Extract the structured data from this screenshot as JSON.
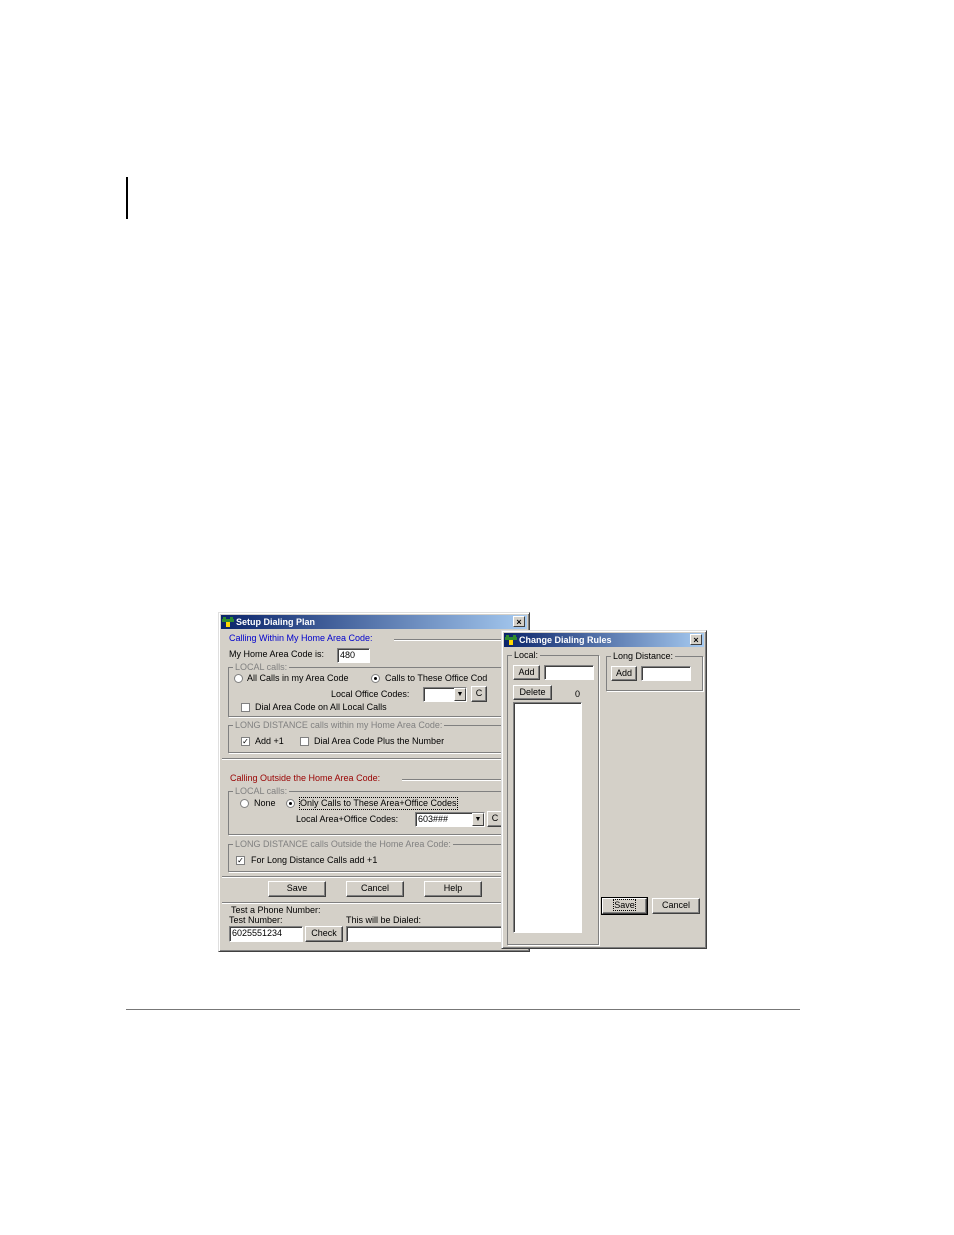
{
  "setup_dialog": {
    "title": "Setup Dialing Plan",
    "close": "×",
    "within_home": {
      "heading": "Calling Within My Home Area Code:",
      "home_area_label": "My Home Area Code is:",
      "home_area_value": "480",
      "local_calls": {
        "title": "LOCAL calls:",
        "option_all": "All Calls in my Area Code",
        "option_these": "Calls to These Office Cod",
        "selected": "option_these",
        "office_codes_label": "Local Office Codes:",
        "office_codes_value": "",
        "c_button": "C",
        "dial_area_code_label": "Dial Area Code on All Local Calls",
        "dial_area_code_checked": false
      },
      "long_distance": {
        "title": "LONG DISTANCE calls within my Home Area Code:",
        "add_one_label": "Add +1",
        "add_one_checked": true,
        "dial_area_plus_label": "Dial Area Code Plus the Number",
        "dial_area_plus_checked": false
      }
    },
    "outside_home": {
      "heading": "Calling Outside the Home Area Code:",
      "local_calls": {
        "title": "LOCAL calls:",
        "option_none": "None",
        "option_only": "Only Calls to These Area+Office Codes",
        "selected": "option_only",
        "codes_label": "Local Area+Office Codes:",
        "codes_value": "603###",
        "c_button": "C"
      },
      "long_distance": {
        "title": "LONG DISTANCE calls Outside the Home Area Code:",
        "add_one_label": "For Long Distance Calls add +1",
        "add_one_checked": true
      }
    },
    "buttons": {
      "save": "Save",
      "cancel": "Cancel",
      "help": "Help"
    },
    "test": {
      "title": "Test a Phone Number:",
      "number_label": "Test Number:",
      "number_value": "6025551234",
      "check_button": "Check",
      "dialed_label": "This will be Dialed:",
      "dialed_value": ""
    }
  },
  "rules_dialog": {
    "title": "Change Dialing Rules",
    "close": "×",
    "local": {
      "title": "Local:",
      "add_button": "Add",
      "add_value": "",
      "delete_button": "Delete",
      "count": "0"
    },
    "long_distance": {
      "title": "Long Distance:",
      "add_button": "Add",
      "add_value": ""
    },
    "buttons": {
      "save": "Save",
      "cancel": "Cancel"
    }
  },
  "icons": {
    "app": "phone-handset-icon",
    "close": "close-icon",
    "dropdown": "chevron-down-icon"
  }
}
